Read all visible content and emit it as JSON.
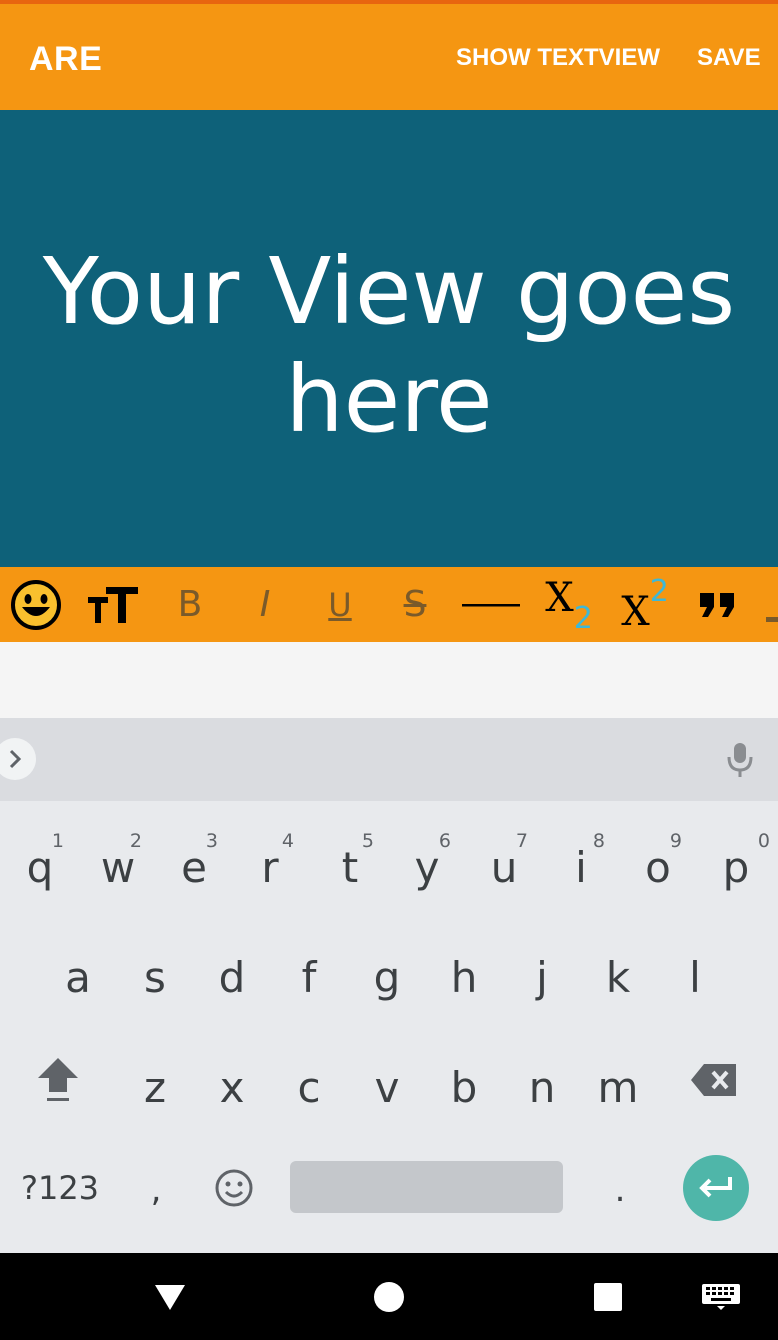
{
  "appbar": {
    "title": "ARE",
    "show_textview": "SHOW TEXTVIEW",
    "save": "SAVE"
  },
  "content": {
    "hero_text": "Your View goes here",
    "background": "#0e6179"
  },
  "toolbar": {
    "items": [
      {
        "name": "emoji-icon"
      },
      {
        "name": "font-size-icon"
      },
      {
        "name": "bold-icon",
        "label": "B"
      },
      {
        "name": "italic-icon",
        "label": "I"
      },
      {
        "name": "underline-icon",
        "label": "U"
      },
      {
        "name": "strikethrough-icon",
        "label": "S"
      },
      {
        "name": "horizontal-rule-icon"
      },
      {
        "name": "subscript-icon",
        "label": "X",
        "sub": "2"
      },
      {
        "name": "superscript-icon",
        "label": "X",
        "sup": "2"
      },
      {
        "name": "quote-icon"
      }
    ]
  },
  "keyboard": {
    "row1": [
      {
        "key": "q",
        "hint": "1"
      },
      {
        "key": "w",
        "hint": "2"
      },
      {
        "key": "e",
        "hint": "3"
      },
      {
        "key": "r",
        "hint": "4"
      },
      {
        "key": "t",
        "hint": "5"
      },
      {
        "key": "y",
        "hint": "6"
      },
      {
        "key": "u",
        "hint": "7"
      },
      {
        "key": "i",
        "hint": "8"
      },
      {
        "key": "o",
        "hint": "9"
      },
      {
        "key": "p",
        "hint": "0"
      }
    ],
    "row2": [
      "a",
      "s",
      "d",
      "f",
      "g",
      "h",
      "j",
      "k",
      "l"
    ],
    "row3": [
      "z",
      "x",
      "c",
      "v",
      "b",
      "n",
      "m"
    ],
    "symbols_key": "?123",
    "comma_key": ",",
    "period_key": ".",
    "accent": "#4fb6a9"
  },
  "colors": {
    "appbar": "#f59612",
    "status_accent": "#e8650f",
    "subscript_accent": "#3fb8d6"
  }
}
